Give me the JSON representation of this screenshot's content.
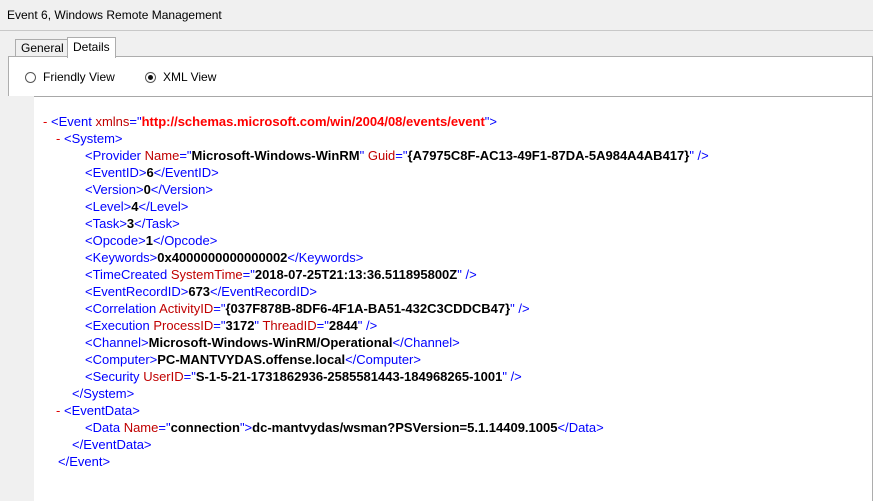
{
  "window": {
    "title": "Event 6, Windows Remote Management"
  },
  "tabs": [
    {
      "label": "General",
      "active": false
    },
    {
      "label": "Details",
      "active": true
    }
  ],
  "view_options": {
    "friendly": {
      "label": "Friendly View",
      "selected": false
    },
    "xml": {
      "label": "XML View",
      "selected": true
    }
  },
  "xml": {
    "event_tag": "Event",
    "xmlns_attr": "xmlns",
    "xmlns_value": "http://schemas.microsoft.com/win/2004/08/events/event",
    "system_tag": "System",
    "provider": {
      "tag": "Provider",
      "name_attr": "Name",
      "name": "Microsoft-Windows-WinRM",
      "guid_attr": "Guid",
      "guid": "{A7975C8F-AC13-49F1-87DA-5A984A4AB417}"
    },
    "event_id": {
      "tag": "EventID",
      "value": "6"
    },
    "version": {
      "tag": "Version",
      "value": "0"
    },
    "level": {
      "tag": "Level",
      "value": "4"
    },
    "task": {
      "tag": "Task",
      "value": "3"
    },
    "opcode": {
      "tag": "Opcode",
      "value": "1"
    },
    "keywords": {
      "tag": "Keywords",
      "value": "0x4000000000000002"
    },
    "time_created": {
      "tag": "TimeCreated",
      "attr": "SystemTime",
      "value": "2018-07-25T21:13:36.511895800Z"
    },
    "event_record_id": {
      "tag": "EventRecordID",
      "value": "673"
    },
    "correlation": {
      "tag": "Correlation",
      "attr": "ActivityID",
      "value": "{037F878B-8DF6-4F1A-BA51-432C3CDDCB47}"
    },
    "execution": {
      "tag": "Execution",
      "pid_attr": "ProcessID",
      "pid": "3172",
      "tid_attr": "ThreadID",
      "tid": "2844"
    },
    "channel": {
      "tag": "Channel",
      "value": "Microsoft-Windows-WinRM/Operational"
    },
    "computer": {
      "tag": "Computer",
      "value": "PC-MANTVYDAS.offense.local"
    },
    "security": {
      "tag": "Security",
      "attr": "UserID",
      "value": "S-1-5-21-1731862936-2585581443-184968265-1001"
    },
    "event_data_tag": "EventData",
    "data": {
      "tag": "Data",
      "attr": "Name",
      "name": "connection",
      "value": "dc-mantvydas/wsman?PSVersion=5.1.14409.1005"
    }
  }
}
